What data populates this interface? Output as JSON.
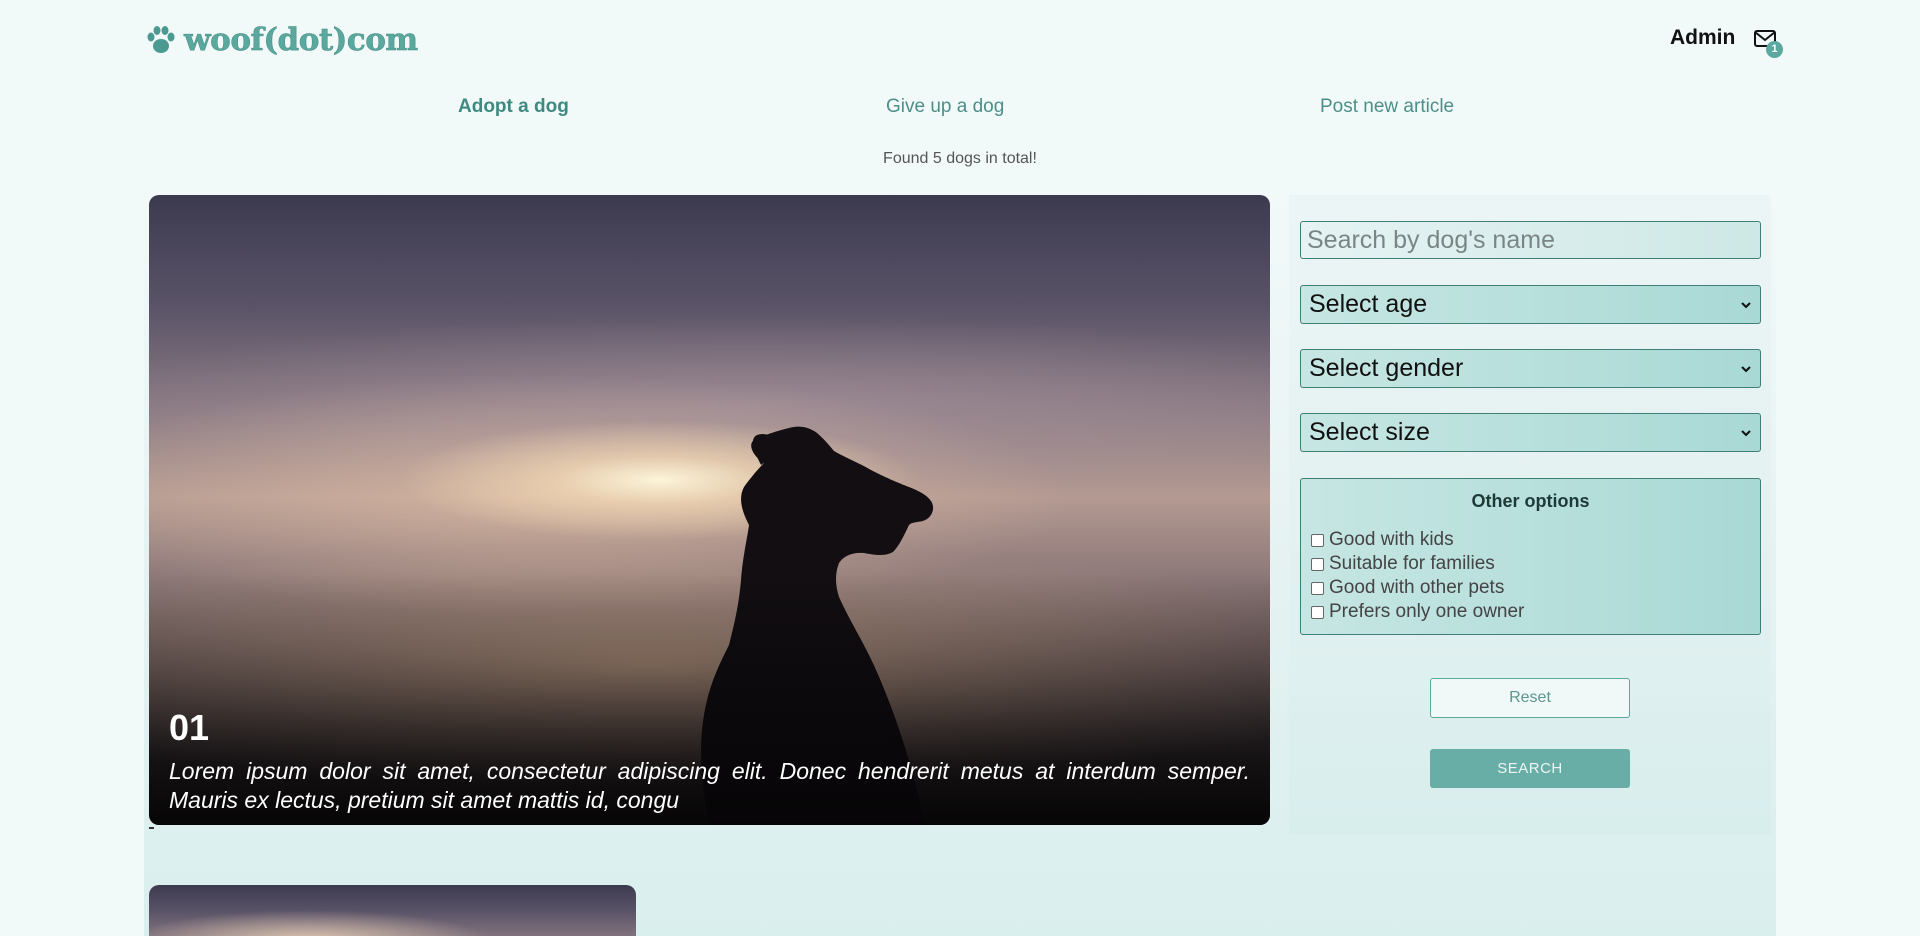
{
  "header": {
    "logo_text": "woof(dot)com",
    "user_name": "Admin",
    "mail_badge": "1"
  },
  "nav": {
    "items": [
      {
        "label": "Adopt a dog",
        "active": true
      },
      {
        "label": "Give up a dog",
        "active": false
      },
      {
        "label": "Post new article",
        "active": false
      }
    ]
  },
  "results": {
    "summary": "Found 5 dogs in total!"
  },
  "hero": {
    "number": "01",
    "description": "Lorem ipsum dolor sit amet, consectetur adipiscing elit. Donec hendrerit metus at interdum semper. Mauris ex lectus, pretium sit amet mattis id, congu"
  },
  "filters": {
    "search_placeholder": "Search by dog's name",
    "age": "Select age",
    "gender": "Select gender",
    "size": "Select size",
    "other_options_title": "Other options",
    "options": [
      {
        "label": "Good with kids",
        "checked": false
      },
      {
        "label": "Suitable for families",
        "checked": false
      },
      {
        "label": "Good with other pets",
        "checked": false
      },
      {
        "label": "Prefers only one owner",
        "checked": false
      }
    ],
    "reset_label": "Reset",
    "search_label": "SEARCH"
  },
  "colors": {
    "brand": "#5aa89e",
    "search_button": "#69aea6",
    "select_fill": "#a9d9d5"
  },
  "icons": {
    "logo": "paw-icon",
    "mail": "mail-icon",
    "select": "chevron-down-icon"
  }
}
